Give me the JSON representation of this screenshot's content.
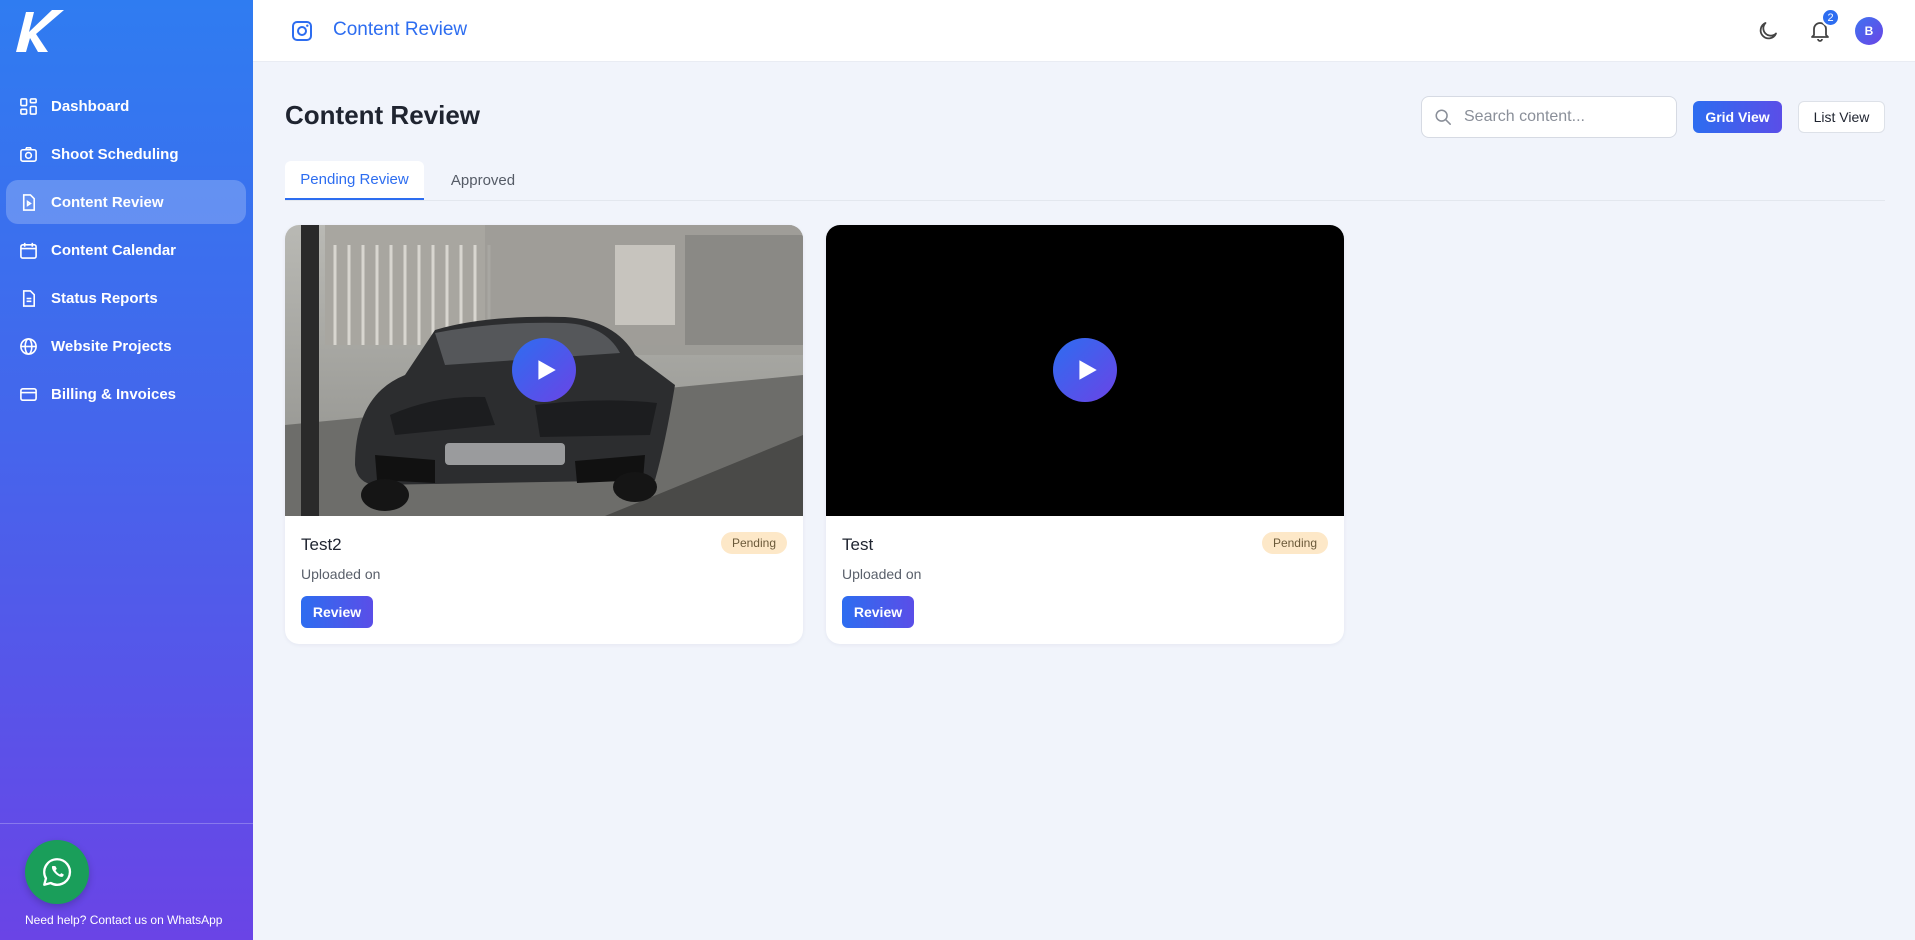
{
  "app": {
    "logo_letter": "K"
  },
  "sidebar": {
    "items": [
      {
        "label": "Dashboard",
        "icon": "dashboard-icon",
        "active": false
      },
      {
        "label": "Shoot Scheduling",
        "icon": "camera-icon",
        "active": false
      },
      {
        "label": "Content Review",
        "icon": "file-play-icon",
        "active": true
      },
      {
        "label": "Content Calendar",
        "icon": "calendar-icon",
        "active": false
      },
      {
        "label": "Status Reports",
        "icon": "report-icon",
        "active": false
      },
      {
        "label": "Website Projects",
        "icon": "globe-icon",
        "active": false
      },
      {
        "label": "Billing & Invoices",
        "icon": "credit-card-icon",
        "active": false
      }
    ],
    "help_text": "Need help? Contact us on WhatsApp"
  },
  "header": {
    "title": "Content Review",
    "icon": "instagram-icon",
    "notification_count": "2",
    "avatar_initial": "B"
  },
  "main": {
    "page_title": "Content Review",
    "search": {
      "placeholder": "Search content...",
      "value": ""
    },
    "view_buttons": {
      "grid": "Grid View",
      "list": "List View",
      "selected": "grid"
    },
    "tabs": [
      {
        "label": "Pending Review",
        "active": true
      },
      {
        "label": "Approved",
        "active": false
      }
    ],
    "cards": [
      {
        "title": "Test2",
        "status": "Pending",
        "uploaded": "Uploaded on",
        "action": "Review",
        "thumbnail": "car-photo"
      },
      {
        "title": "Test",
        "status": "Pending",
        "uploaded": "Uploaded on",
        "action": "Review",
        "thumbnail": "black"
      }
    ]
  },
  "colors": {
    "accent": "#2d6df0",
    "sidebar_gradient_start": "#2f7cf1",
    "sidebar_gradient_end": "#6a44e6",
    "pending_bg": "#fde8c8",
    "whatsapp": "#1a9e5a"
  }
}
